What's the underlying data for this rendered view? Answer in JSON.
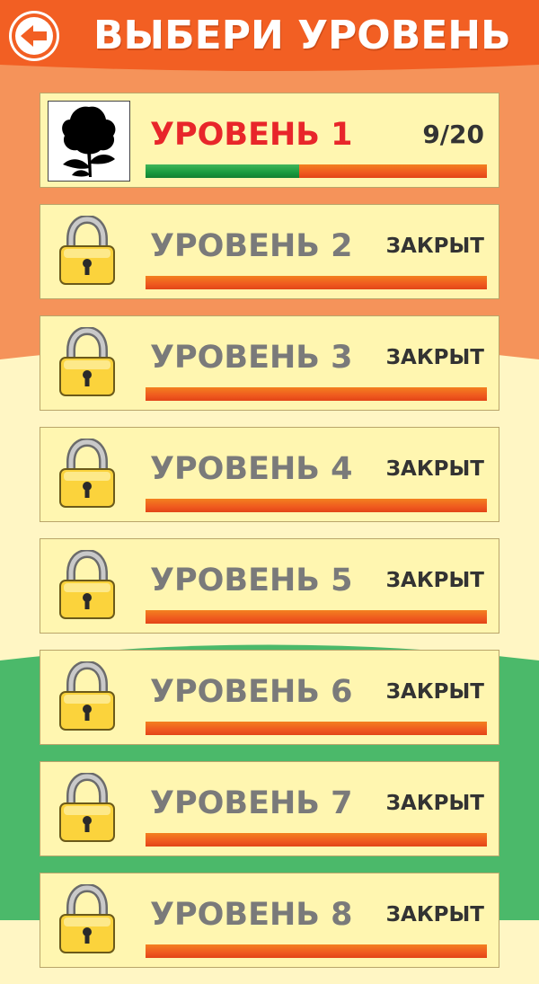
{
  "header": {
    "title": "ВЫБЕРИ УРОВЕНЬ",
    "back_icon": "arrow-left-icon"
  },
  "colors": {
    "header_orange": "#f25f23",
    "upper_band": "#f5935a",
    "cream_band": "#fff6c4",
    "lower_band": "#4bb96a",
    "card_background": "#fff6b0",
    "active_level_name": "#e8262a",
    "locked_level_name": "#7a7a7a",
    "progress_green": "#1a9a3e",
    "progress_orange": "#ef5a1f"
  },
  "levels": [
    {
      "name": "УРОВЕНЬ 1",
      "status": "9/20",
      "locked": false,
      "icon": "rose-silhouette-icon",
      "progress": 0.45
    },
    {
      "name": "УРОВЕНЬ 2",
      "status": "ЗАКРЫТ",
      "locked": true,
      "icon": "padlock-icon",
      "progress": 0
    },
    {
      "name": "УРОВЕНЬ 3",
      "status": "ЗАКРЫТ",
      "locked": true,
      "icon": "padlock-icon",
      "progress": 0
    },
    {
      "name": "УРОВЕНЬ 4",
      "status": "ЗАКРЫТ",
      "locked": true,
      "icon": "padlock-icon",
      "progress": 0
    },
    {
      "name": "УРОВЕНЬ 5",
      "status": "ЗАКРЫТ",
      "locked": true,
      "icon": "padlock-icon",
      "progress": 0
    },
    {
      "name": "УРОВЕНЬ 6",
      "status": "ЗАКРЫТ",
      "locked": true,
      "icon": "padlock-icon",
      "progress": 0
    },
    {
      "name": "УРОВЕНЬ 7",
      "status": "ЗАКРЫТ",
      "locked": true,
      "icon": "padlock-icon",
      "progress": 0
    },
    {
      "name": "УРОВЕНЬ 8",
      "status": "ЗАКРЫТ",
      "locked": true,
      "icon": "padlock-icon",
      "progress": 0
    }
  ]
}
